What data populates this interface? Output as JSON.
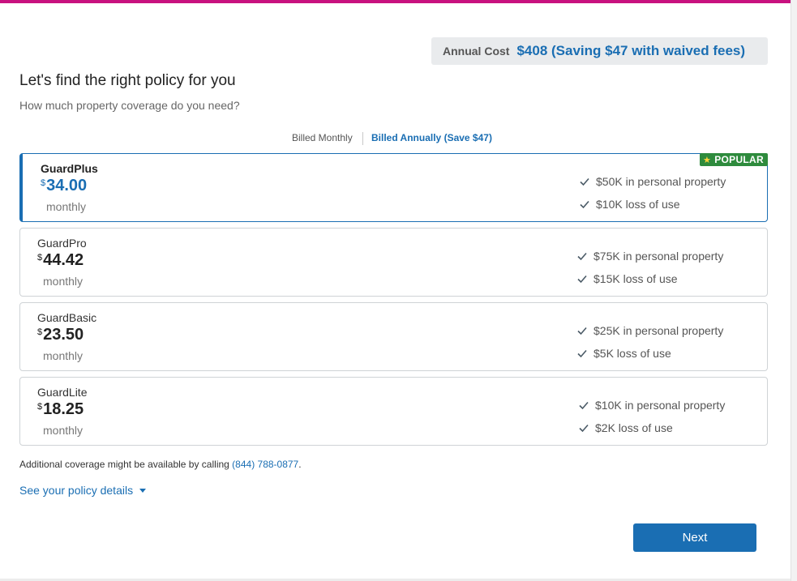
{
  "header": {
    "annual_cost_label": "Annual Cost",
    "annual_cost_value": "$408 (Saving $47 with waived fees)"
  },
  "main": {
    "title": "Let's find the right policy for you",
    "subtitle": "How much property coverage do you need?"
  },
  "billing": {
    "monthly_label": "Billed Monthly",
    "annual_label": "Billed Annually (Save $47)",
    "selected": "annual"
  },
  "plans": [
    {
      "name": "GuardPlus",
      "currency": "$",
      "price": "34.00",
      "period": "monthly",
      "features": [
        "$50K in personal property",
        "$10K loss of use"
      ],
      "selected": true,
      "badge": "POPULAR"
    },
    {
      "name": "GuardPro",
      "currency": "$",
      "price": "44.42",
      "period": "monthly",
      "features": [
        "$75K in personal property",
        "$15K loss of use"
      ],
      "selected": false
    },
    {
      "name": "GuardBasic",
      "currency": "$",
      "price": "23.50",
      "period": "monthly",
      "features": [
        "$25K in personal property",
        "$5K loss of use"
      ],
      "selected": false
    },
    {
      "name": "GuardLite",
      "currency": "$",
      "price": "18.25",
      "period": "monthly",
      "features": [
        "$10K in personal property",
        "$2K loss of use"
      ],
      "selected": false
    }
  ],
  "footer": {
    "note_prefix": "Additional coverage might be available by calling",
    "phone": "(844) 788-0877",
    "note_suffix": ".",
    "details_link": "See your policy details",
    "next_label": "Next"
  },
  "icons": {
    "feature": "check-icon",
    "badge": "star-icon",
    "details": "caret-down-icon"
  },
  "colors": {
    "accent": "#1a6eb3",
    "brand_bar": "#c8117f",
    "badge": "#2e8b3d"
  }
}
